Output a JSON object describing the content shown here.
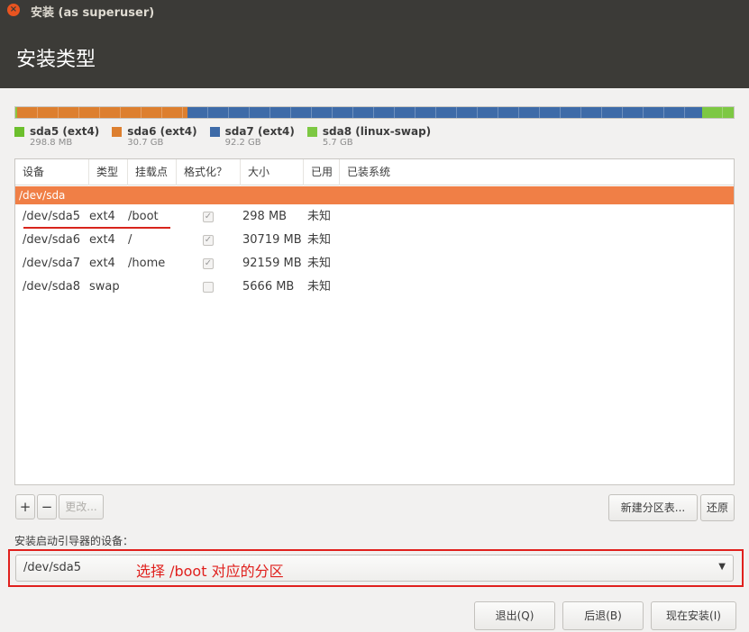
{
  "window": {
    "title": "安装 (as superuser)",
    "close_glyph": "×"
  },
  "page_title": "安装类型",
  "partition_bar": [
    {
      "name": "sda5",
      "color": "#8cc63f",
      "fraction": 0.0023
    },
    {
      "name": "sda6",
      "color": "#dd7f2f",
      "fraction": 0.237
    },
    {
      "name": "sda7",
      "color": "#3e6ba8",
      "fraction": 0.7165
    },
    {
      "name": "sda8",
      "color": "#7dc843",
      "fraction": 0.0442
    }
  ],
  "legend": [
    {
      "name": "sda5 (ext4)",
      "size": "298.8 MB",
      "color": "#6cbf2d"
    },
    {
      "name": "sda6 (ext4)",
      "size": "30.7 GB",
      "color": "#dd7f2f"
    },
    {
      "name": "sda7 (ext4)",
      "size": "92.2 GB",
      "color": "#3e6ba8"
    },
    {
      "name": "sda8 (linux-swap)",
      "size": "5.7 GB",
      "color": "#7dc843"
    }
  ],
  "table": {
    "headers": [
      "设备",
      "类型",
      "挂载点",
      "格式化？",
      "大小",
      "已用",
      "已装系统"
    ],
    "disk_row": "/dev/sda",
    "rows": [
      {
        "device": "/dev/sda5",
        "type": "ext4",
        "mount": "/boot",
        "format": true,
        "size": "298 MB",
        "used": "未知"
      },
      {
        "device": "/dev/sda6",
        "type": "ext4",
        "mount": "/",
        "format": true,
        "size": "30719 MB",
        "used": "未知"
      },
      {
        "device": "/dev/sda7",
        "type": "ext4",
        "mount": "/home",
        "format": true,
        "size": "92159 MB",
        "used": "未知"
      },
      {
        "device": "/dev/sda8",
        "type": "swap",
        "mount": "",
        "format": false,
        "size": "5666 MB",
        "used": "未知"
      }
    ]
  },
  "toolbar": {
    "add": "+",
    "remove": "−",
    "change": "更改...",
    "new_table": "新建分区表...",
    "revert": "还原"
  },
  "bootloader": {
    "label": "安装启动引导器的设备：",
    "value": "/dev/sda5",
    "annotation": "选择 /boot 对应的分区",
    "arrow": "▼"
  },
  "footer": {
    "quit": "退出(Q)",
    "back": "后退(B)",
    "install": "现在安装(I)"
  }
}
